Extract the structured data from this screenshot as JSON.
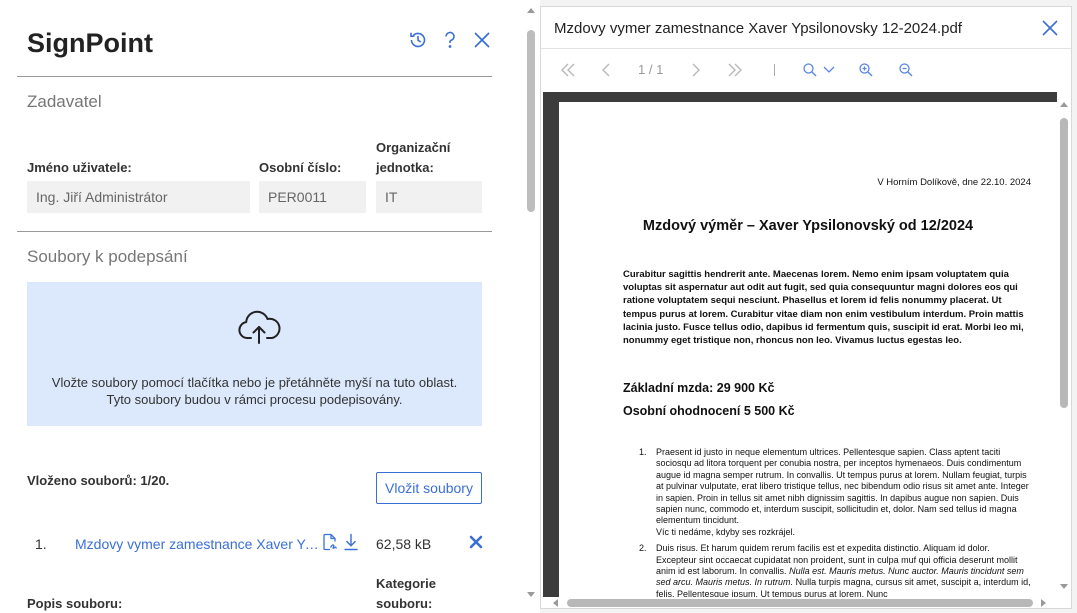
{
  "app": {
    "title": "SignPoint"
  },
  "header_icons": [
    "history-icon",
    "help-icon",
    "close-icon"
  ],
  "requester": {
    "section_title": "Zadavatel",
    "name_label": "Jméno uživatele:",
    "name_value": "Ing. Jiří Administrátor",
    "personal_no_label": "Osobní číslo:",
    "personal_no_value": "PER0011",
    "org_unit_label": "Organizační jednotka:",
    "org_unit_value": "IT"
  },
  "files": {
    "section_title": "Soubory k podepsání",
    "dropzone_line1": "Vložte soubory pomocí tlačítka nebo je přetáhněte myší na tuto oblast.",
    "dropzone_line2": "Tyto soubory budou v rámci procesu podepisovány.",
    "count_label": "Vloženo souborů: 1/20.",
    "upload_button": "Vložit soubory",
    "items": [
      {
        "index": "1.",
        "name": "Mzdovy vymer zamestnance Xaver Ypsilonovsky 12-2024.pdf",
        "size": "62,58 kB"
      }
    ],
    "description_label": "Popis souboru:",
    "category_label": "Kategorie souboru:"
  },
  "pdf_viewer": {
    "title": "Mzdovy vymer zamestnance Xaver Ypsilonovsky 12-2024.pdf",
    "page_indicator": "1 / 1",
    "document": {
      "date_line": "V Horním Dolíkově, dne 22.10. 2024",
      "heading": "Mzdový výměr – Xaver Ypsilonovský od 12/2024",
      "intro": "Curabitur sagittis hendrerit ante. Maecenas lorem. Nemo enim ipsam voluptatem quia voluptas sit aspernatur aut odit aut fugit, sed quia consequuntur magni dolores eos qui ratione voluptatem sequi nesciunt. Phasellus et lorem id felis nonummy placerat. Ut tempus purus at lorem. Curabitur vitae diam non enim vestibulum interdum. Proin mattis lacinia justo. Fusce tellus odio, dapibus id fermentum quis, suscipit id erat. Morbi leo mi, nonummy eget tristique non, rhoncus non leo. Vivamus luctus egestas leo.",
      "base_salary": "Základní mzda: 29 900 Kč",
      "personal_bonus": "Osobní ohodnocení 5 500 Kč",
      "list_1_num": "1.",
      "list_1_text": "Praesent id justo in neque elementum ultrices. Pellentesque sapien. Class aptent taciti sociosqu ad litora torquent per conubia nostra, per inceptos hymenaeos. Duis condimentum augue id magna semper rutrum. In convallis. Ut tempus purus at lorem. Nullam feugiat, turpis at pulvinar vulputate, erat libero tristique tellus, nec bibendum odio risus sit amet ante. Integer in sapien. Proin in tellus sit amet nibh dignissim sagittis. In dapibus augue non sapien. Duis sapien nunc, commodo et, interdum suscipit, sollicitudin et, dolor. Nam sed tellus id magna elementum tincidunt.",
      "list_1_extra": "Víc ti nedáme, kdyby ses rozkrájel.",
      "list_2_num": "2.",
      "list_2_a": "Duis risus. Et harum quidem rerum facilis est et expedita distinctio. Aliquam id dolor. Excepteur sint occaecat cupidatat non proident, sunt in culpa muf qui officia deserunt mollit anim id est laborum. In convallis.",
      "list_2_italic": "Nulla est. Mauris metus. Nunc auctor. Mauris tincidunt sem sed arcu. Mauris metus. In rutrum.",
      "list_2_b": "Nulla turpis magna, cursus sit amet, suscipit a, interdum id, felis. Pellentesque ipsum. Ut tempus purus at lorem. Nunc"
    }
  },
  "colors": {
    "accent": "#3a6fd8",
    "dropzone_bg": "#dce8fb",
    "input_bg": "#f1f1f1",
    "viewer_bg": "#3c3c3c"
  }
}
